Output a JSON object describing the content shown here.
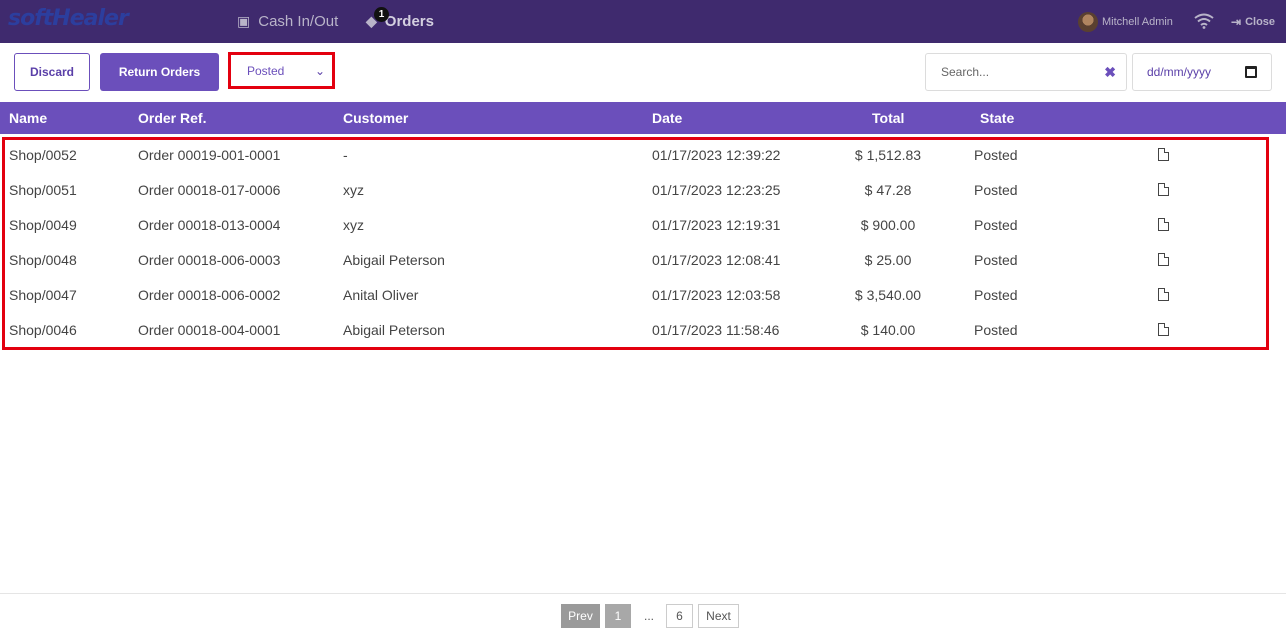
{
  "app": {
    "logo_text": "softHealer"
  },
  "nav": {
    "cash_label": "Cash In/Out",
    "orders_label": "Orders",
    "orders_badge": "1"
  },
  "user": {
    "name": "Mitchell Admin",
    "close_label": "Close"
  },
  "toolbar": {
    "discard_label": "Discard",
    "return_label": "Return Orders",
    "state_filter": "Posted",
    "search_placeholder": "Search...",
    "date_placeholder": "dd/mm/yyyy"
  },
  "table": {
    "headers": [
      "Name",
      "Order Ref.",
      "Customer",
      "Date",
      "Total",
      "State"
    ],
    "rows": [
      {
        "name": "Shop/0052",
        "ref": "Order 00019-001-0001",
        "customer": "-",
        "date": "01/17/2023 12:39:22",
        "total": "$ 1,512.83",
        "state": "Posted"
      },
      {
        "name": "Shop/0051",
        "ref": "Order 00018-017-0006",
        "customer": "xyz",
        "date": "01/17/2023 12:23:25",
        "total": "$ 47.28",
        "state": "Posted"
      },
      {
        "name": "Shop/0049",
        "ref": "Order 00018-013-0004",
        "customer": "xyz",
        "date": "01/17/2023 12:19:31",
        "total": "$ 900.00",
        "state": "Posted"
      },
      {
        "name": "Shop/0048",
        "ref": "Order 00018-006-0003",
        "customer": "Abigail Peterson",
        "date": "01/17/2023 12:08:41",
        "total": "$ 25.00",
        "state": "Posted"
      },
      {
        "name": "Shop/0047",
        "ref": "Order 00018-006-0002",
        "customer": "Anital Oliver",
        "date": "01/17/2023 12:03:58",
        "total": "$ 3,540.00",
        "state": "Posted"
      },
      {
        "name": "Shop/0046",
        "ref": "Order 00018-004-0001",
        "customer": "Abigail Peterson",
        "date": "01/17/2023 11:58:46",
        "total": "$ 140.00",
        "state": "Posted"
      }
    ]
  },
  "pagination": {
    "prev": "Prev",
    "current": "1",
    "ellipsis": "...",
    "last": "6",
    "next": "Next"
  },
  "colors": {
    "topbar": "#3f2a6e",
    "accent": "#6b4fbb",
    "highlight": "#e3000f"
  }
}
